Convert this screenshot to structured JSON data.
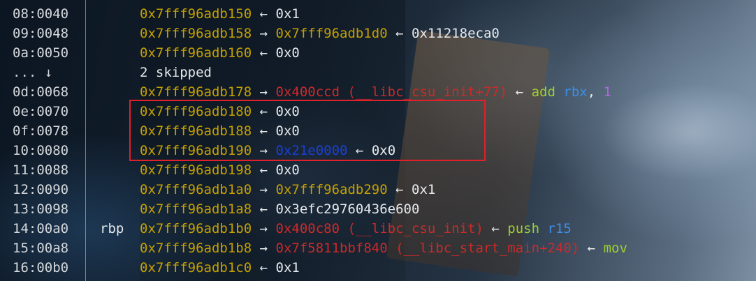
{
  "stack": {
    "rows": [
      {
        "offset": "08:0040",
        "reg": "",
        "address": "0x7fff96adb150",
        "arrow1": "←",
        "v1": "0x1",
        "v1_type": "val"
      },
      {
        "offset": "09:0048",
        "reg": "",
        "address": "0x7fff96adb158",
        "arrow1": "→",
        "v1": "0x7fff96adb1d0",
        "v1_type": "addr",
        "arrow2": "←",
        "v2": "0x11218eca0"
      },
      {
        "offset": "0a:0050",
        "reg": "",
        "address": "0x7fff96adb160",
        "arrow1": "←",
        "v1": "0x0",
        "v1_type": "val"
      },
      {
        "offset": "... ↓",
        "reg": "",
        "skipped": "2 skipped"
      },
      {
        "offset": "0d:0068",
        "reg": "",
        "address": "0x7fff96adb178",
        "arrow1": "→",
        "v1": "0x400ccd (__libc_csu_init+77)",
        "v1_type": "code",
        "arrow2": "←",
        "instr": "add",
        "operand1": "rbx",
        "sep": ",",
        "operand2": "1"
      },
      {
        "offset": "0e:0070",
        "reg": "",
        "address": "0x7fff96adb180",
        "arrow1": "←",
        "v1": "0x0",
        "v1_type": "val"
      },
      {
        "offset": "0f:0078",
        "reg": "",
        "address": "0x7fff96adb188",
        "arrow1": "←",
        "v1": "0x0",
        "v1_type": "val"
      },
      {
        "offset": "10:0080",
        "reg": "",
        "address": "0x7fff96adb190",
        "arrow1": "→",
        "v1": "0x21e0000",
        "v1_type": "heap",
        "arrow2": "←",
        "v2": "0x0"
      },
      {
        "offset": "11:0088",
        "reg": "",
        "address": "0x7fff96adb198",
        "arrow1": "←",
        "v1": "0x0",
        "v1_type": "val"
      },
      {
        "offset": "12:0090",
        "reg": "",
        "address": "0x7fff96adb1a0",
        "arrow1": "→",
        "v1": "0x7fff96adb290",
        "v1_type": "addr",
        "arrow2": "←",
        "v2": "0x1"
      },
      {
        "offset": "13:0098",
        "reg": "",
        "address": "0x7fff96adb1a8",
        "arrow1": "←",
        "v1": "0x3efc29760436e600",
        "v1_type": "val"
      },
      {
        "offset": "14:00a0",
        "reg": "rbp",
        "address": "0x7fff96adb1b0",
        "arrow1": "→",
        "v1": "0x400c80 (__libc_csu_init)",
        "v1_type": "code",
        "arrow2": "←",
        "instr": "push",
        "operand1": "r15"
      },
      {
        "offset": "15:00a8",
        "reg": "",
        "address": "0x7fff96adb1b8",
        "arrow1": "→",
        "v1": "0x7f5811bbf840 (__libc_start_main+240)",
        "v1_type": "code",
        "arrow2": "←",
        "instr": "mov"
      },
      {
        "offset": "16:00b0",
        "reg": "",
        "address": "0x7fff96adb1c0",
        "arrow1": "←",
        "v1": "0x1",
        "v1_type": "val"
      }
    ]
  },
  "colors": {
    "address": "#c4a000",
    "code_pointer": "#cc2a2a",
    "heap_pointer": "#1a3fd6",
    "instruction": "#9ed033",
    "register": "#3d8fe6",
    "immediate": "#b266e0",
    "highlight_border": "#e0202a"
  }
}
